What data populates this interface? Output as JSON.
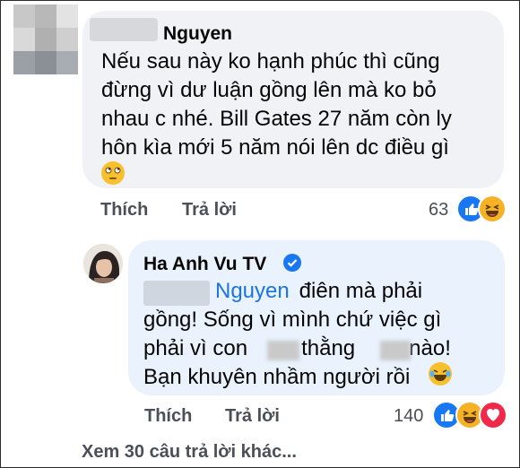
{
  "comment1": {
    "author": "Nguyen",
    "lines": [
      "Nếu sau này ko hạnh phúc thì cũng",
      "đừng vì dư luận gồng lên mà ko bỏ",
      "nhau c nhé. Bill Gates 27 năm còn ly",
      "hôn kìa mới 5 năm nói lên dc điều gì"
    ],
    "emoji": "rolling-eyes-emoji",
    "like_label": "Thích",
    "reply_label": "Trả lời",
    "reaction_count": "63",
    "reactions": [
      "like",
      "haha"
    ]
  },
  "comment2": {
    "author": "Ha Anh Vu TV",
    "verified": true,
    "mention": "Nguyen",
    "line1_rest": " điên mà phải",
    "lines": [
      "gồng! Sống vì mình chứ việc gì",
      "phải vì con         thằng         nào!",
      "Bạn khuyên nhầm người rồi"
    ],
    "emoji": "laughing-tears-emoji",
    "like_label": "Thích",
    "reply_label": "Trả lời",
    "reaction_count": "140",
    "reactions": [
      "like",
      "haha",
      "love"
    ]
  },
  "more_replies": "Xem 30 câu trả lời khác...",
  "colors": {
    "bubble": "#f0f2f5",
    "highlight_bubble": "#e9f2fd",
    "link": "#1b74e4",
    "like": "#1877f2",
    "haha": "#f7b125",
    "love": "#f02849"
  }
}
